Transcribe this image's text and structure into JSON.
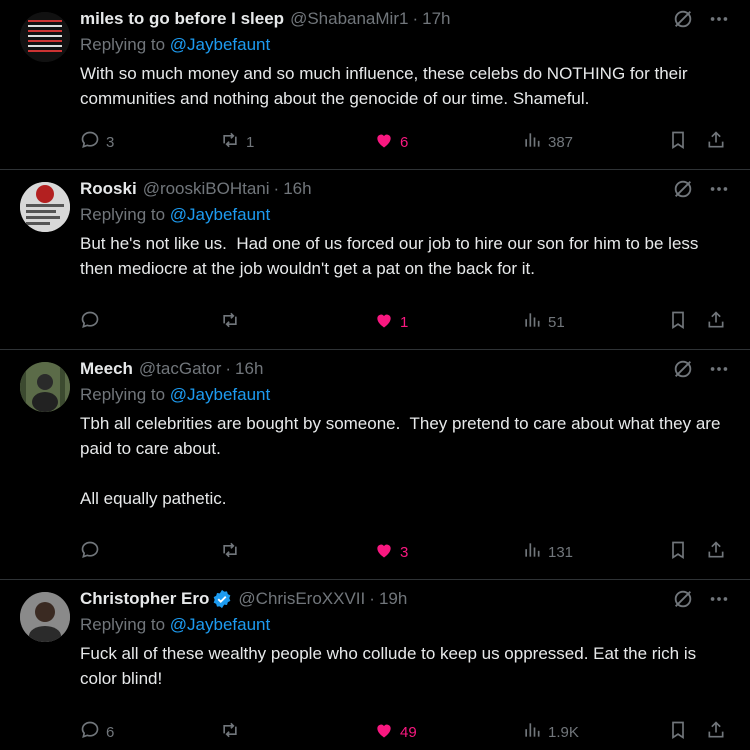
{
  "tweets": [
    {
      "name": "miles to go before I sleep",
      "handle": "@ShabanaMir1",
      "time": "17h",
      "replying_prefix": "Replying to",
      "replying_to": "@Jaybefaunt",
      "text": "With so much money and so much influence, these celebs do NOTHING for their communities and nothing about the genocide of our time. Shameful.",
      "replies": "3",
      "retweets": "1",
      "likes": "6",
      "views": "387",
      "verified": false,
      "avatar_color": "#1a1a1a"
    },
    {
      "name": "Rooski",
      "handle": "@rooskiBOHtani",
      "time": "16h",
      "replying_prefix": "Replying to",
      "replying_to": "@Jaybefaunt",
      "text": "But he's not like us.  Had one of us forced our job to hire our son for him to be less then mediocre at the job wouldn't get a pat on the back for it.",
      "replies": "",
      "retweets": "",
      "likes": "1",
      "views": "51",
      "verified": false,
      "avatar_color": "#c8c8c8"
    },
    {
      "name": "Meech",
      "handle": "@tacGator",
      "time": "16h",
      "replying_prefix": "Replying to",
      "replying_to": "@Jaybefaunt",
      "text": "Tbh all celebrities are bought by someone.  They pretend to care about what they are paid to care about.\n\nAll equally pathetic.",
      "replies": "",
      "retweets": "",
      "likes": "3",
      "views": "131",
      "verified": false,
      "avatar_color": "#4a5a3c"
    },
    {
      "name": "Christopher Ero",
      "handle": "@ChrisEroXXVII",
      "time": "19h",
      "replying_prefix": "Replying to",
      "replying_to": "@Jaybefaunt",
      "text": "Fuck all of these wealthy people who collude to keep us oppressed. Eat the rich is color blind!",
      "replies": "6",
      "retweets": "",
      "likes": "49",
      "views": "1.9K",
      "verified": true,
      "avatar_color": "#6b6b6b"
    }
  ],
  "icons": {
    "reply": "reply-icon",
    "retweet": "retweet-icon",
    "like": "heart-icon",
    "views": "views-icon",
    "bookmark": "bookmark-icon",
    "share": "share-icon",
    "grok": "grok-icon",
    "more": "more-icon"
  },
  "colors": {
    "background": "#000000",
    "text": "#e7e9ea",
    "muted": "#71767b",
    "link": "#1d9bf0",
    "like": "#f91880",
    "divider": "#2f3336"
  }
}
